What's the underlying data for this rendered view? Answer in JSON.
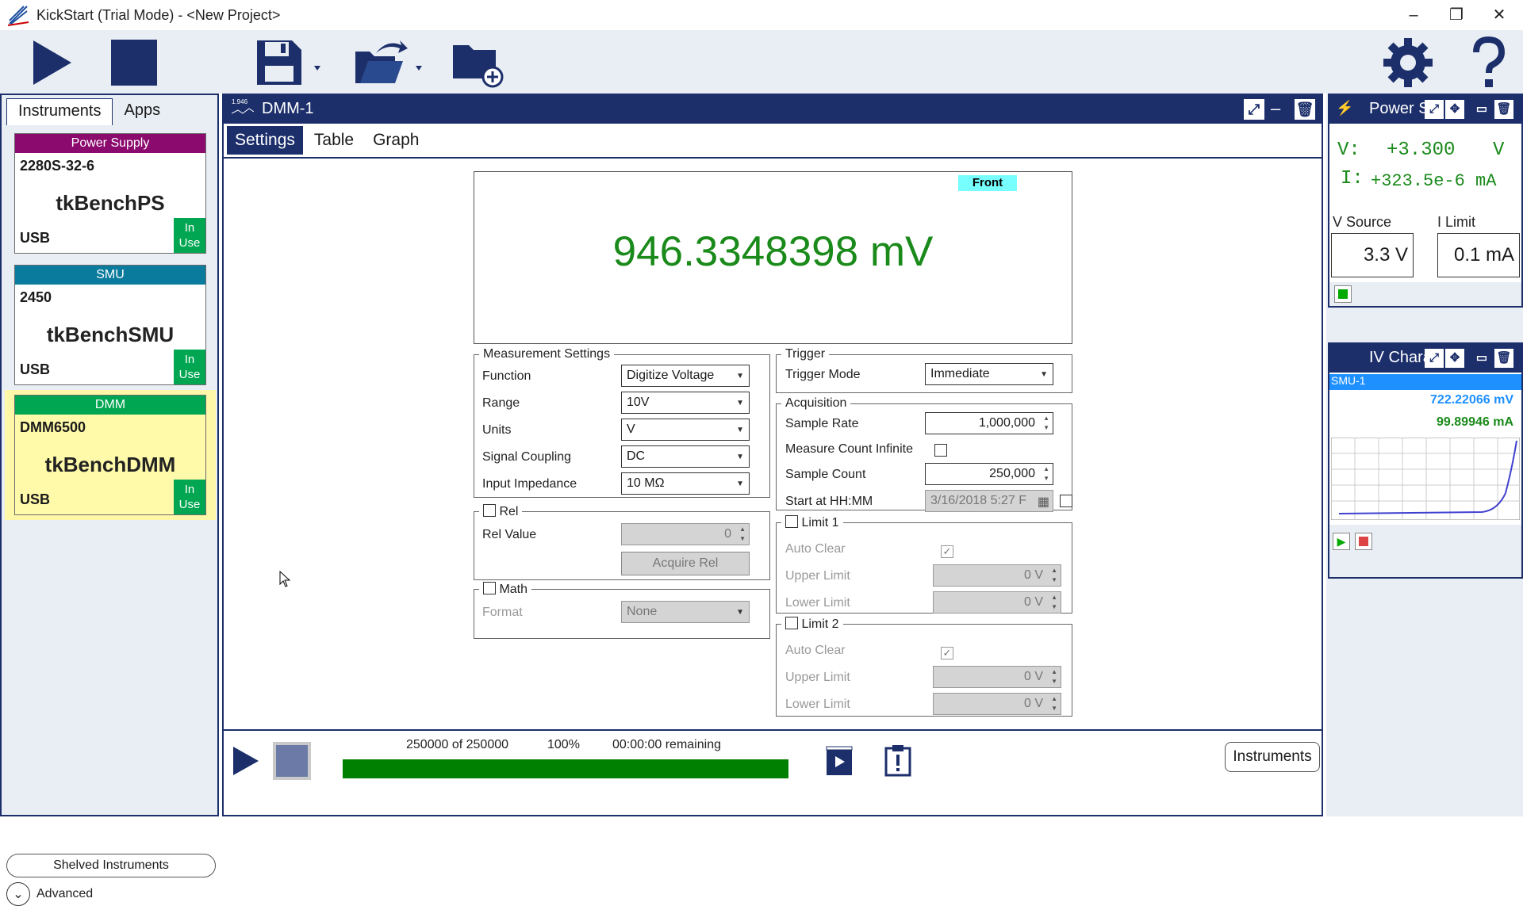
{
  "window": {
    "title": "KickStart (Trial Mode) - <New Project>",
    "min": "–",
    "restore": "❐",
    "close": "✕"
  },
  "left_panel": {
    "tabs": [
      "Instruments",
      "Apps"
    ],
    "instruments": [
      {
        "type": "Power Supply",
        "model": "2280S-32-6",
        "name": "tkBenchPS",
        "port": "USB",
        "status": "In Use",
        "color": "#8b0a6e"
      },
      {
        "type": "SMU",
        "model": "2450",
        "name": "tkBenchSMU",
        "port": "USB",
        "status": "In Use",
        "color": "#0a7b9c"
      },
      {
        "type": "DMM",
        "model": "DMM6500",
        "name": "tkBenchDMM",
        "port": "USB",
        "status": "In Use",
        "color": "#00a651"
      }
    ],
    "shelved": "Shelved Instruments",
    "advanced": "Advanced"
  },
  "main": {
    "title": "DMM-1",
    "header_icon_text": "1.946",
    "tabs": [
      "Settings",
      "Table",
      "Graph"
    ],
    "display": {
      "terminal": "Front",
      "reading": "946.3348398 mV"
    },
    "measurement": {
      "legend": "Measurement Settings",
      "function_label": "Function",
      "function_value": "Digitize Voltage",
      "range_label": "Range",
      "range_value": "10V",
      "units_label": "Units",
      "units_value": "V",
      "coupling_label": "Signal Coupling",
      "coupling_value": "DC",
      "impedance_label": "Input Impedance",
      "impedance_value": "10 MΩ"
    },
    "rel": {
      "legend": "Rel",
      "value_label": "Rel Value",
      "value": "0",
      "acquire": "Acquire Rel"
    },
    "math": {
      "legend": "Math",
      "format_label": "Format",
      "format_value": "None"
    },
    "trigger": {
      "legend": "Trigger",
      "mode_label": "Trigger Mode",
      "mode_value": "Immediate"
    },
    "acquisition": {
      "legend": "Acquisition",
      "rate_label": "Sample Rate",
      "rate_value": "1,000,000",
      "infinite_label": "Measure Count Infinite",
      "count_label": "Sample Count",
      "count_value": "250,000",
      "start_label": "Start at HH:MM",
      "start_value": "3/16/2018 5:27 F"
    },
    "limit1": {
      "legend": "Limit 1",
      "auto_clear": "Auto Clear",
      "upper_label": "Upper Limit",
      "upper_value": "0 V",
      "lower_label": "Lower Limit",
      "lower_value": "0 V"
    },
    "limit2": {
      "legend": "Limit 2",
      "auto_clear": "Auto Clear",
      "upper_label": "Upper Limit",
      "upper_value": "0 V",
      "lower_label": "Lower Limit",
      "lower_value": "0 V"
    },
    "status": {
      "count": "250000 of 250000",
      "percent": "100%",
      "remaining": "00:00:00 remaining",
      "progress": 1.0
    },
    "instruments_button": "Instruments"
  },
  "right_panel": {
    "power": {
      "title": "Power S",
      "v_label": "V:",
      "v_value": "+3.300",
      "v_unit": "V",
      "i_label": "I:",
      "i_value": "+323.5e-6 mA",
      "vsource_label": "V Source",
      "vsource_value": "3.3 V",
      "ilimit_label": "I Limit",
      "ilimit_value": "0.1 mA"
    },
    "iv": {
      "title": "IV Chara",
      "device": "SMU-1",
      "voltage": "722.22066 mV",
      "current": "99.89946 mA"
    }
  }
}
